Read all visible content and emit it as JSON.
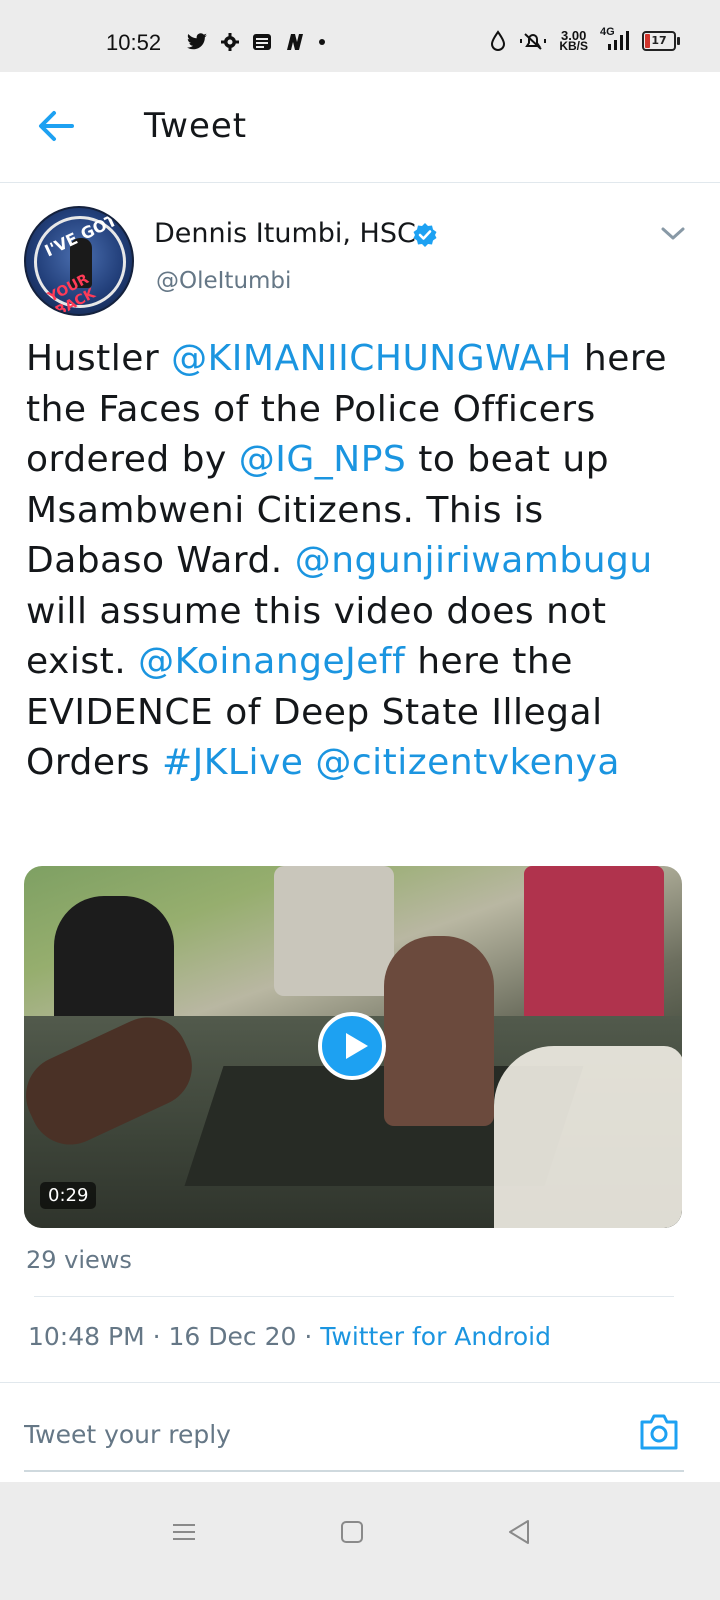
{
  "status_bar": {
    "time": "10:52",
    "icons_left": [
      "twitter-icon",
      "gear-icon",
      "news-icon",
      "n-icon",
      "dot-icon"
    ],
    "net_speed": "3.00",
    "net_unit": "KB/S",
    "network": "4G",
    "battery": "17"
  },
  "appbar": {
    "title": "Tweet"
  },
  "tweet": {
    "author_name": "Dennis Itumbi, HSC",
    "author_handle": "@OleItumbi",
    "avatar_text_top": "I'VE GOT",
    "avatar_text_bottom": "YOUR BACK",
    "text_parts": [
      {
        "t": "Hustler ",
        "link": false
      },
      {
        "t": "@KIMANIICHUNGWAH",
        "link": true
      },
      {
        "t": " here the Faces of the Police Officers ordered by ",
        "link": false
      },
      {
        "t": "@IG_NPS",
        "link": true
      },
      {
        "t": " to beat up Msambweni Citizens. This is Dabaso Ward. ",
        "link": false
      },
      {
        "t": "@ngunjiriwambugu",
        "link": true
      },
      {
        "t": " will assume this video does not exist. ",
        "link": false
      },
      {
        "t": "@KoinangeJeff",
        "link": true
      },
      {
        "t": " here the EVIDENCE of Deep State Illegal Orders ",
        "link": false
      },
      {
        "t": "#JKLive",
        "link": true
      },
      {
        "t": " ",
        "link": false
      },
      {
        "t": "@citizentvkenya",
        "link": true
      }
    ],
    "video_duration": "0:29",
    "views": "29 views",
    "time": "10:48 PM",
    "date": "16 Dec 20",
    "separator": " · ",
    "source": "Twitter for Android"
  },
  "reply": {
    "placeholder": "Tweet your reply"
  },
  "colors": {
    "link": "#1b95e0",
    "accent": "#1da1f2",
    "muted": "#657786"
  }
}
